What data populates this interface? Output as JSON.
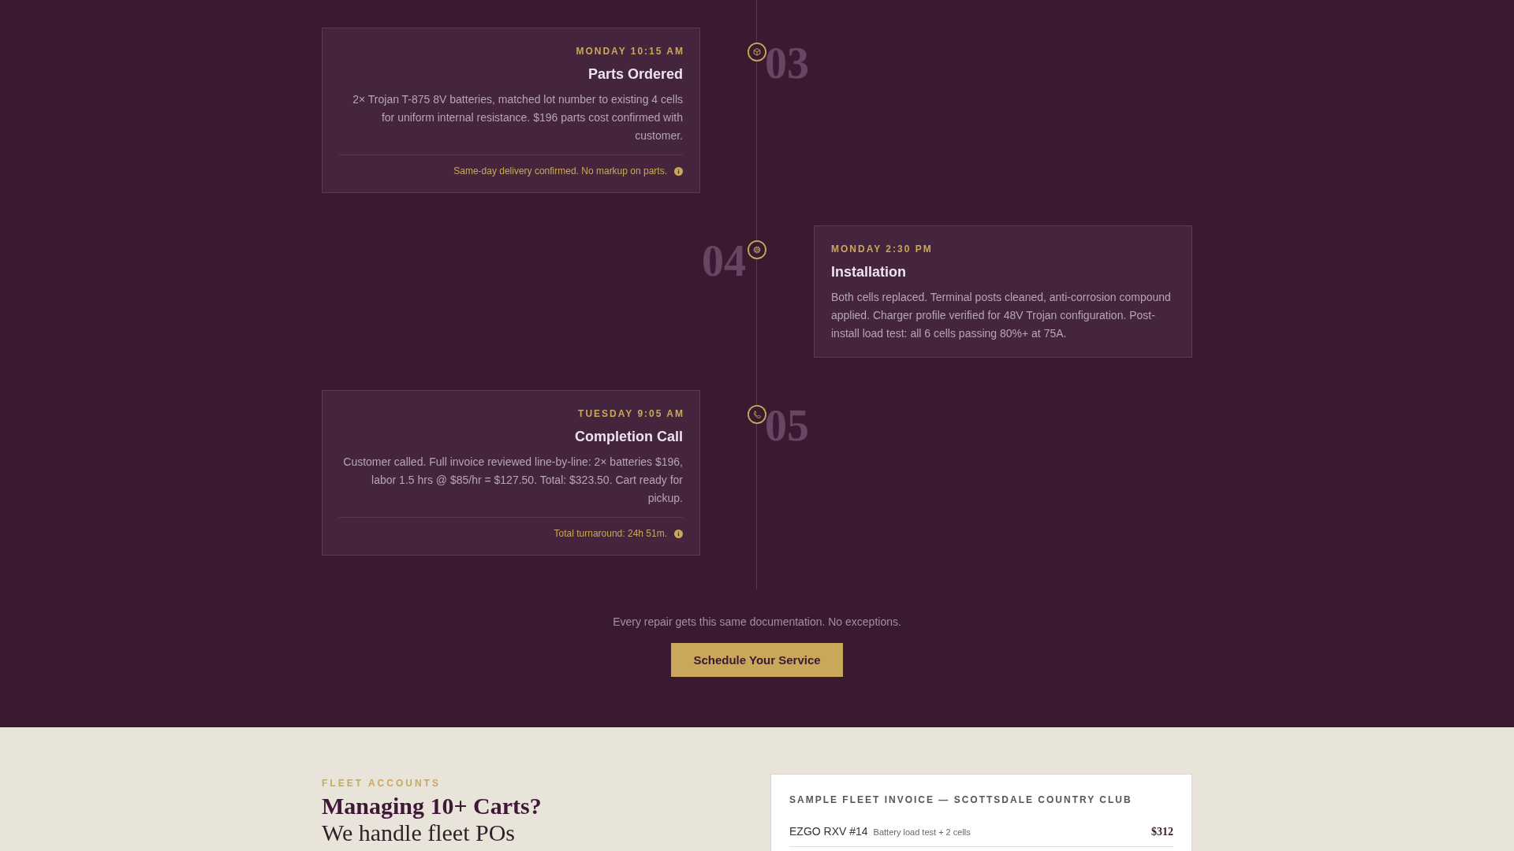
{
  "timeline": {
    "steps": [
      {
        "number": "03",
        "time": "MONDAY 10:15 AM",
        "title": "Parts Ordered",
        "body": "2× Trojan T-875 8V batteries, matched lot number to existing 4 cells for uniform internal resistance. $196 parts cost confirmed with customer.",
        "note": "Same-day delivery confirmed. No markup on parts."
      },
      {
        "number": "04",
        "time": "MONDAY 2:30 PM",
        "title": "Installation",
        "body": "Both cells replaced. Terminal posts cleaned, anti-corrosion compound applied. Charger profile verified for 48V Trojan configuration. Post-install load test: all 6 cells passing 80%+ at 75A."
      },
      {
        "number": "05",
        "time": "TUESDAY 9:05 AM",
        "title": "Completion Call",
        "body": "Customer called. Full invoice reviewed line-by-line: 2× batteries $196, labor 1.5 hrs @ $85/hr = $127.50. Total: $323.50. Cart ready for pickup.",
        "note": "Total turnaround: 24h 51m."
      }
    ]
  },
  "cta": {
    "text": "Every repair gets this same documentation. No exceptions.",
    "button": "Schedule Your Service"
  },
  "fleet": {
    "eyebrow": "FLEET ACCOUNTS",
    "heading": "Managing 10+ Carts?",
    "subheading": "We handle fleet POs",
    "invoice": {
      "title": "SAMPLE FLEET INVOICE — SCOTTSDALE COUNTRY CLUB",
      "rows": [
        {
          "item": "EZGO RXV #14",
          "detail": "Battery load test + 2 cells",
          "amount": "$312"
        }
      ]
    }
  }
}
